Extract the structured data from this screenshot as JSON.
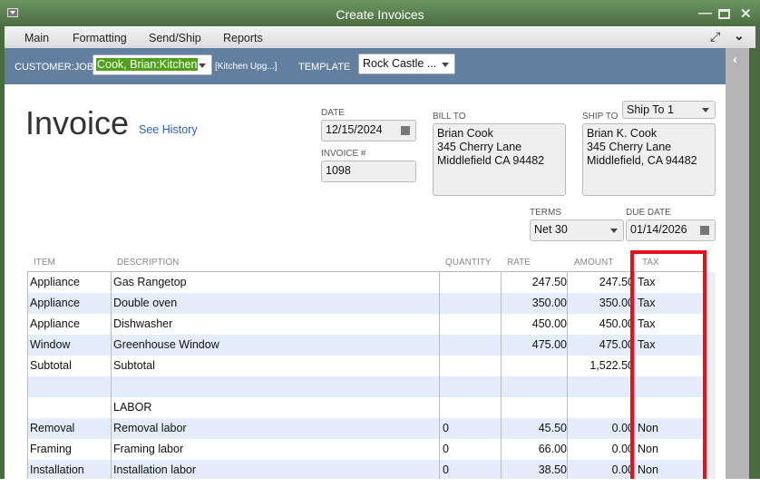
{
  "window": {
    "title": "Create Invoices"
  },
  "menu": [
    "Main",
    "Formatting",
    "Send/Ship",
    "Reports"
  ],
  "customer_bar": {
    "customer_label": "CUSTOMER:JOB",
    "customer_value": "Cook, Brian:Kitchen",
    "job_note": "[Kitchen Upg...]",
    "template_label": "TEMPLATE",
    "template_value": "Rock Castle ..."
  },
  "invoice": {
    "heading": "Invoice",
    "see_history": "See History",
    "date_label": "DATE",
    "date": "12/15/2024",
    "invoice_no_label": "INVOICE #",
    "invoice_no": "1098",
    "bill_to_label": "BILL TO",
    "bill_to": [
      "Brian Cook",
      "345 Cherry Lane",
      "Middlefield CA 94482"
    ],
    "ship_to_label": "SHIP TO",
    "ship_to_select": "Ship To 1",
    "ship_to": [
      "Brian K. Cook",
      "345 Cherry Lane",
      "Middlefield, CA 94482"
    ],
    "terms_label": "TERMS",
    "terms": "Net 30",
    "due_date_label": "DUE DATE",
    "due_date": "01/14/2026"
  },
  "table": {
    "headers": [
      "ITEM",
      "DESCRIPTION",
      "QUANTITY",
      "RATE",
      "AMOUNT",
      "TAX"
    ],
    "rows": [
      [
        "Appliance",
        "Gas Rangetop",
        "",
        "247.50",
        "247.50",
        "Tax"
      ],
      [
        "Appliance",
        "Double oven",
        "",
        "350.00",
        "350.00",
        "Tax"
      ],
      [
        "Appliance",
        "Dishwasher",
        "",
        "450.00",
        "450.00",
        "Tax"
      ],
      [
        "Window",
        "Greenhouse Window",
        "",
        "475.00",
        "475.00",
        "Tax"
      ],
      [
        "Subtotal",
        "Subtotal",
        "",
        "",
        "1,522.50",
        ""
      ],
      [
        "",
        "",
        "",
        "",
        "",
        ""
      ],
      [
        "",
        "LABOR",
        "",
        "",
        "",
        ""
      ],
      [
        "Removal",
        "Removal labor",
        "0",
        "45.50",
        "0.00",
        "Non"
      ],
      [
        "Framing",
        "Framing labor",
        "0",
        "66.00",
        "0.00",
        "Non"
      ],
      [
        "Installation",
        "Installation labor",
        "0",
        "38.50",
        "0.00",
        "Non"
      ]
    ]
  },
  "colors": {
    "highlight": "#e8101a",
    "title_bar": "#4a6b3f",
    "customer_bar": "#627f9f"
  }
}
